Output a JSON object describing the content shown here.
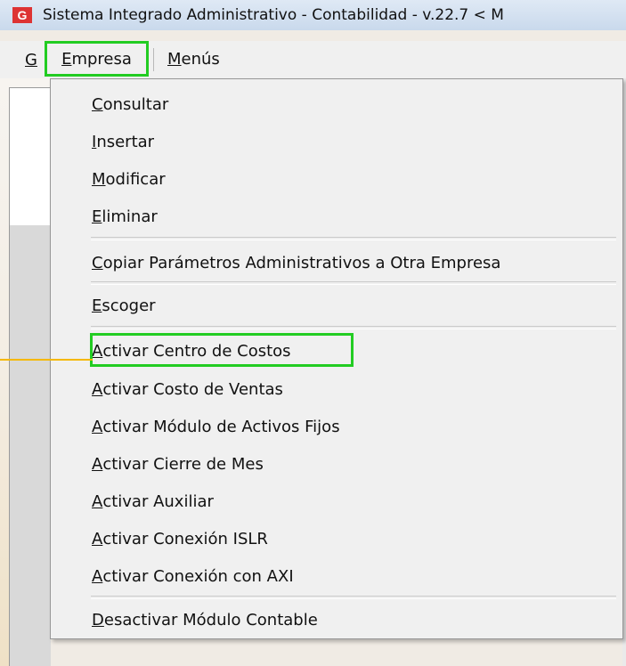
{
  "window": {
    "title": "Sistema Integrado Administrativo - Contabilidad - v.22.7 < M",
    "icon_letter": "G"
  },
  "menubar": {
    "g": "G",
    "empresa": {
      "first": "E",
      "rest": "mpresa"
    },
    "menus": {
      "first": "M",
      "rest": "enús"
    }
  },
  "menu_items": [
    {
      "first": "C",
      "rest": "onsultar"
    },
    {
      "first": "I",
      "rest": "nsertar"
    },
    {
      "first": "M",
      "rest": "odificar"
    },
    {
      "first": "E",
      "rest": "liminar"
    },
    {
      "first": "C",
      "rest": "opiar Parámetros Administrativos a Otra Empresa"
    },
    {
      "first": "E",
      "rest": "scoger"
    },
    {
      "first": "A",
      "rest": "ctivar Centro de Costos"
    },
    {
      "first": "A",
      "rest": "ctivar Costo de Ventas"
    },
    {
      "first": "A",
      "rest": "ctivar Módulo de Activos Fijos"
    },
    {
      "first": "A",
      "rest": "ctivar Cierre de Mes"
    },
    {
      "first": "A",
      "rest": "ctivar Auxiliar"
    },
    {
      "first": "A",
      "rest": "ctivar Conexión ISLR"
    },
    {
      "first": "A",
      "rest": "ctivar Conexión con AXI"
    },
    {
      "first": "D",
      "rest": "esactivar Módulo Contable"
    }
  ],
  "colors": {
    "highlight": "#22cc22",
    "leader_line": "#f5b800",
    "app_icon": "#dd3333"
  }
}
